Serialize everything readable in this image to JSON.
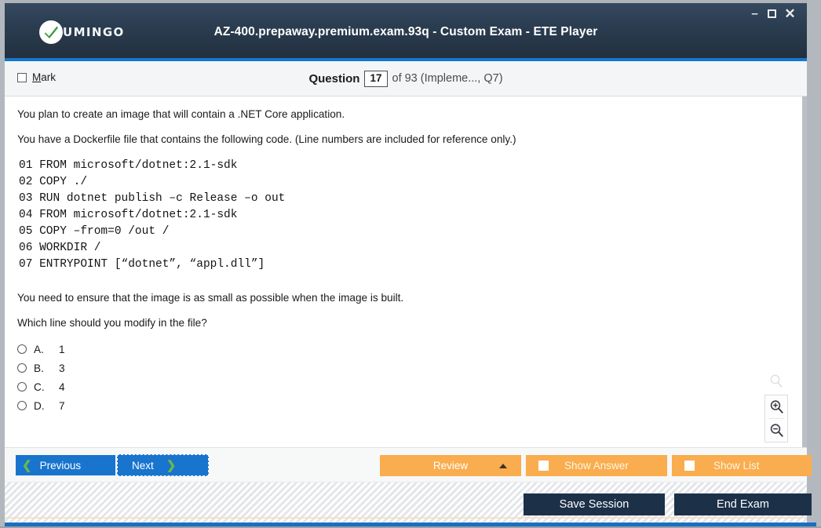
{
  "window": {
    "title": "AZ-400.prepaway.premium.exam.93q - Custom Exam - ETE Player",
    "controls": {
      "minimize": "–",
      "maximize": "",
      "close": "✕"
    }
  },
  "brand": {
    "name": "UMINGO",
    "accent_green": "#3a9e3f",
    "titlebar_dark": "#2b3d51",
    "accent_blue": "#1478cd",
    "accent_orange": "#f9ad4e"
  },
  "question_header": {
    "mark_label_pre": "M",
    "mark_label_post": "ark",
    "mark_checked": false,
    "question_word": "Question",
    "current_number": "17",
    "of_text": "of 93 (Impleme..., Q7)"
  },
  "question": {
    "intro_1": "You plan to create an image that will contain a .NET Core application.",
    "intro_2": "You have a Dockerfile file that contains the following code. (Line numbers are included for reference only.)",
    "code_lines": [
      "01 FROM microsoft/dotnet:2.1-sdk",
      "02 COPY ./",
      "03 RUN dotnet publish –c Release –o out",
      "04 FROM microsoft/dotnet:2.1-sdk",
      "05 COPY –from=0 /out /",
      "06 WORKDIR /",
      "07 ENTRYPOINT [“dotnet”, “appl.dll”]"
    ],
    "requirement": "You need to ensure that the image is as small as possible when the image is built.",
    "prompt": "Which line should you modify in the file?",
    "options": [
      {
        "letter": "A.",
        "text": "1",
        "selected": false
      },
      {
        "letter": "B.",
        "text": "3",
        "selected": false
      },
      {
        "letter": "C.",
        "text": "4",
        "selected": false
      },
      {
        "letter": "D.",
        "text": "7",
        "selected": false
      }
    ]
  },
  "zoom_tools": {
    "reset_title": "zoom-reset",
    "in_title": "zoom-in",
    "out_title": "zoom-out"
  },
  "toolbar": {
    "previous_label": "Previous",
    "next_label": "Next",
    "review_label": "Review",
    "show_answer_label": "Show Answer",
    "show_list_label": "Show List"
  },
  "footer": {
    "save_session_label": "Save Session",
    "end_exam_label": "End Exam"
  }
}
